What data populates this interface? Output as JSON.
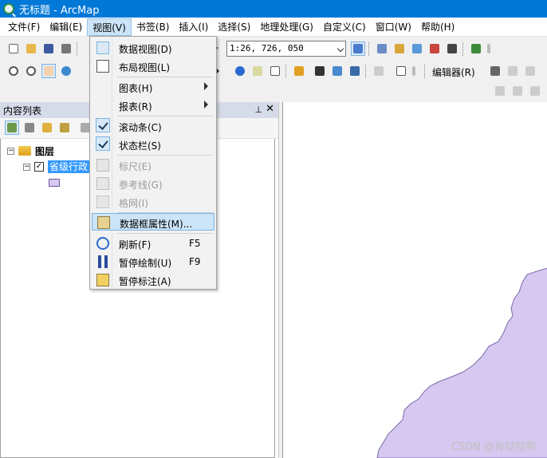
{
  "window": {
    "title": "无标题 - ArcMap"
  },
  "menubar": {
    "items": [
      {
        "label": "文件(F)"
      },
      {
        "label": "编辑(E)"
      },
      {
        "label": "视图(V)"
      },
      {
        "label": "书签(B)"
      },
      {
        "label": "插入(I)"
      },
      {
        "label": "选择(S)"
      },
      {
        "label": "地理处理(G)"
      },
      {
        "label": "自定义(C)"
      },
      {
        "label": "窗口(W)"
      },
      {
        "label": "帮助(H)"
      }
    ]
  },
  "toolbar": {
    "scale_value": "1:26, 726, 050",
    "editor_label": "编辑器(R)"
  },
  "toc": {
    "title": "内容列表",
    "pin_icon": "pin-icon",
    "close_label": "✕",
    "root_label": "图层",
    "layer_label": "省级行政",
    "layer_checked": "✓",
    "expander_open": "−",
    "legend_color": "#d6c8f0"
  },
  "view_menu": {
    "items": [
      {
        "label": "数据视图(D)",
        "icon": "data-view-icon"
      },
      {
        "label": "布局视图(L)",
        "icon": "layout-view-icon"
      },
      {
        "label": "图表(H)",
        "submenu": true
      },
      {
        "label": "报表(R)",
        "submenu": true
      },
      {
        "label": "滚动条(C)",
        "checked": true
      },
      {
        "label": "状态栏(S)",
        "checked": true
      },
      {
        "label": "标尺(E)",
        "disabled": true,
        "icon": "ruler-icon"
      },
      {
        "label": "参考线(G)",
        "disabled": true,
        "icon": "guides-icon"
      },
      {
        "label": "格网(I)",
        "disabled": true,
        "icon": "grid-icon"
      },
      {
        "label": "数据框属性(M)...",
        "icon": "data-frame-properties-icon",
        "highlighted": true
      },
      {
        "label": "刷新(F)",
        "shortcut": "F5",
        "icon": "refresh-icon"
      },
      {
        "label": "暂停绘制(U)",
        "shortcut": "F9",
        "icon": "pause-drawing-icon"
      },
      {
        "label": "暂停标注(A)",
        "icon": "pause-labeling-icon"
      }
    ]
  },
  "map": {
    "fill_color": "#d6c8f0",
    "stroke_color": "#7a6aa8"
  },
  "watermark": "CSDN @肖哒哒啊",
  "colors": {
    "titlebar": "#0078d7",
    "menu_highlight": "#cce4f7",
    "selection": "#3399ff"
  }
}
